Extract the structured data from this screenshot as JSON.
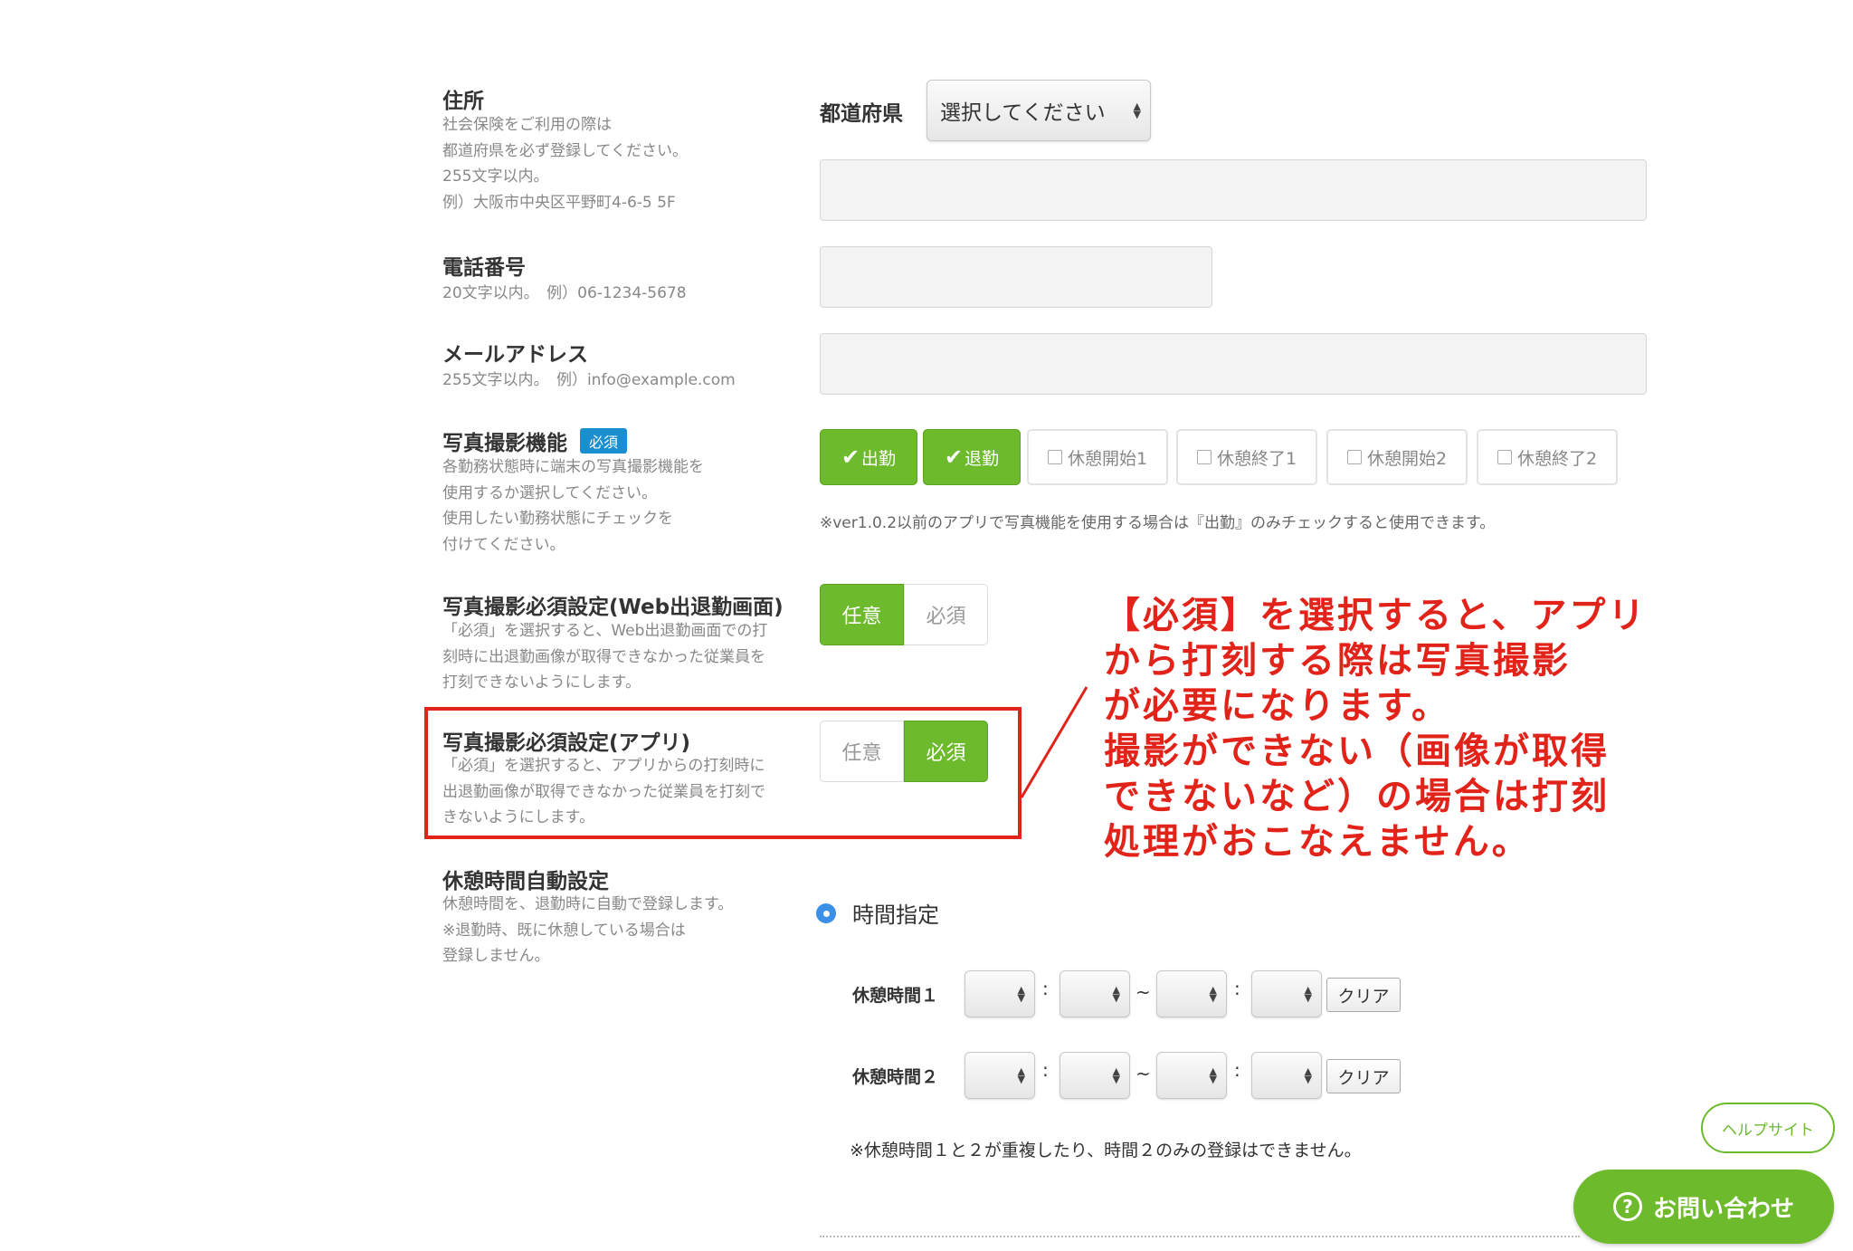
{
  "address": {
    "title": "住所",
    "desc": [
      "社会保険をご利用の際は",
      "都道府県を必ず登録してください。",
      "255文字以内。",
      "例）大阪市中央区平野町4-6-5 5F"
    ],
    "prefecture_label": "都道府県",
    "prefecture_select": "選択してください",
    "address_value": ""
  },
  "phone": {
    "title": "電話番号",
    "desc": [
      "20文字以内。　例）06-1234-5678"
    ],
    "value": ""
  },
  "email": {
    "title": "メールアドレス",
    "desc": [
      "255文字以内。　例）info@example.com"
    ],
    "value": ""
  },
  "photo": {
    "title": "写真撮影機能",
    "badge": "必須",
    "desc": [
      "各勤務状態時に端末の写真撮影機能を",
      "使用するか選択してください。",
      "使用したい勤務状態にチェックを",
      "付けてください。"
    ],
    "options": [
      {
        "label": "出勤",
        "checked": true
      },
      {
        "label": "退勤",
        "checked": true
      },
      {
        "label": "休憩開始1",
        "checked": false
      },
      {
        "label": "休憩終了1",
        "checked": false
      },
      {
        "label": "休憩開始2",
        "checked": false
      },
      {
        "label": "休憩終了2",
        "checked": false
      }
    ],
    "note": "※ver1.0.2以前のアプリで写真機能を使用する場合は『出勤』のみチェックすると使用できます。"
  },
  "photo_web": {
    "title": "写真撮影必須設定(Web出退勤画面)",
    "desc": [
      "「必須」を選択すると、Web出退勤画面での打",
      "刻時に出退勤画像が取得できなかった従業員を",
      "打刻できないようにします。"
    ],
    "opt_optional": "任意",
    "opt_required": "必須",
    "selected": "任意"
  },
  "photo_app": {
    "title": "写真撮影必須設定(アプリ)",
    "desc": [
      "「必須」を選択すると、アプリからの打刻時に",
      "出退勤画像が取得できなかった従業員を打刻で",
      "きないようにします。"
    ],
    "opt_optional": "任意",
    "opt_required": "必須",
    "selected": "必須"
  },
  "annotation": {
    "lines": [
      "【必須】を選択すると、アプリ",
      "から打刻する際は写真撮影",
      "が必要になります。",
      "撮影ができない（画像が取得",
      "できないなど）の場合は打刻",
      "処理がおこなえません。"
    ],
    "color": "#e2231a"
  },
  "break_auto": {
    "title": "休憩時間自動設定",
    "desc": [
      "休憩時間を、退勤時に自動で登録します。",
      "※退勤時、既に休憩している場合は",
      "登録しません。"
    ],
    "radio_label": "時間指定",
    "rows": [
      {
        "label": "休憩時間１",
        "colon": ":",
        "tilde": "~",
        "clear": "クリア"
      },
      {
        "label": "休憩時間２",
        "colon": ":",
        "tilde": "~",
        "clear": "クリア"
      }
    ],
    "note": "※休憩時間１と２が重複したり、時間２のみの登録はできません。"
  },
  "floating": {
    "help_site": "ヘルプサイト",
    "contact": "お問い合わせ",
    "accent": "#6dba2c"
  }
}
